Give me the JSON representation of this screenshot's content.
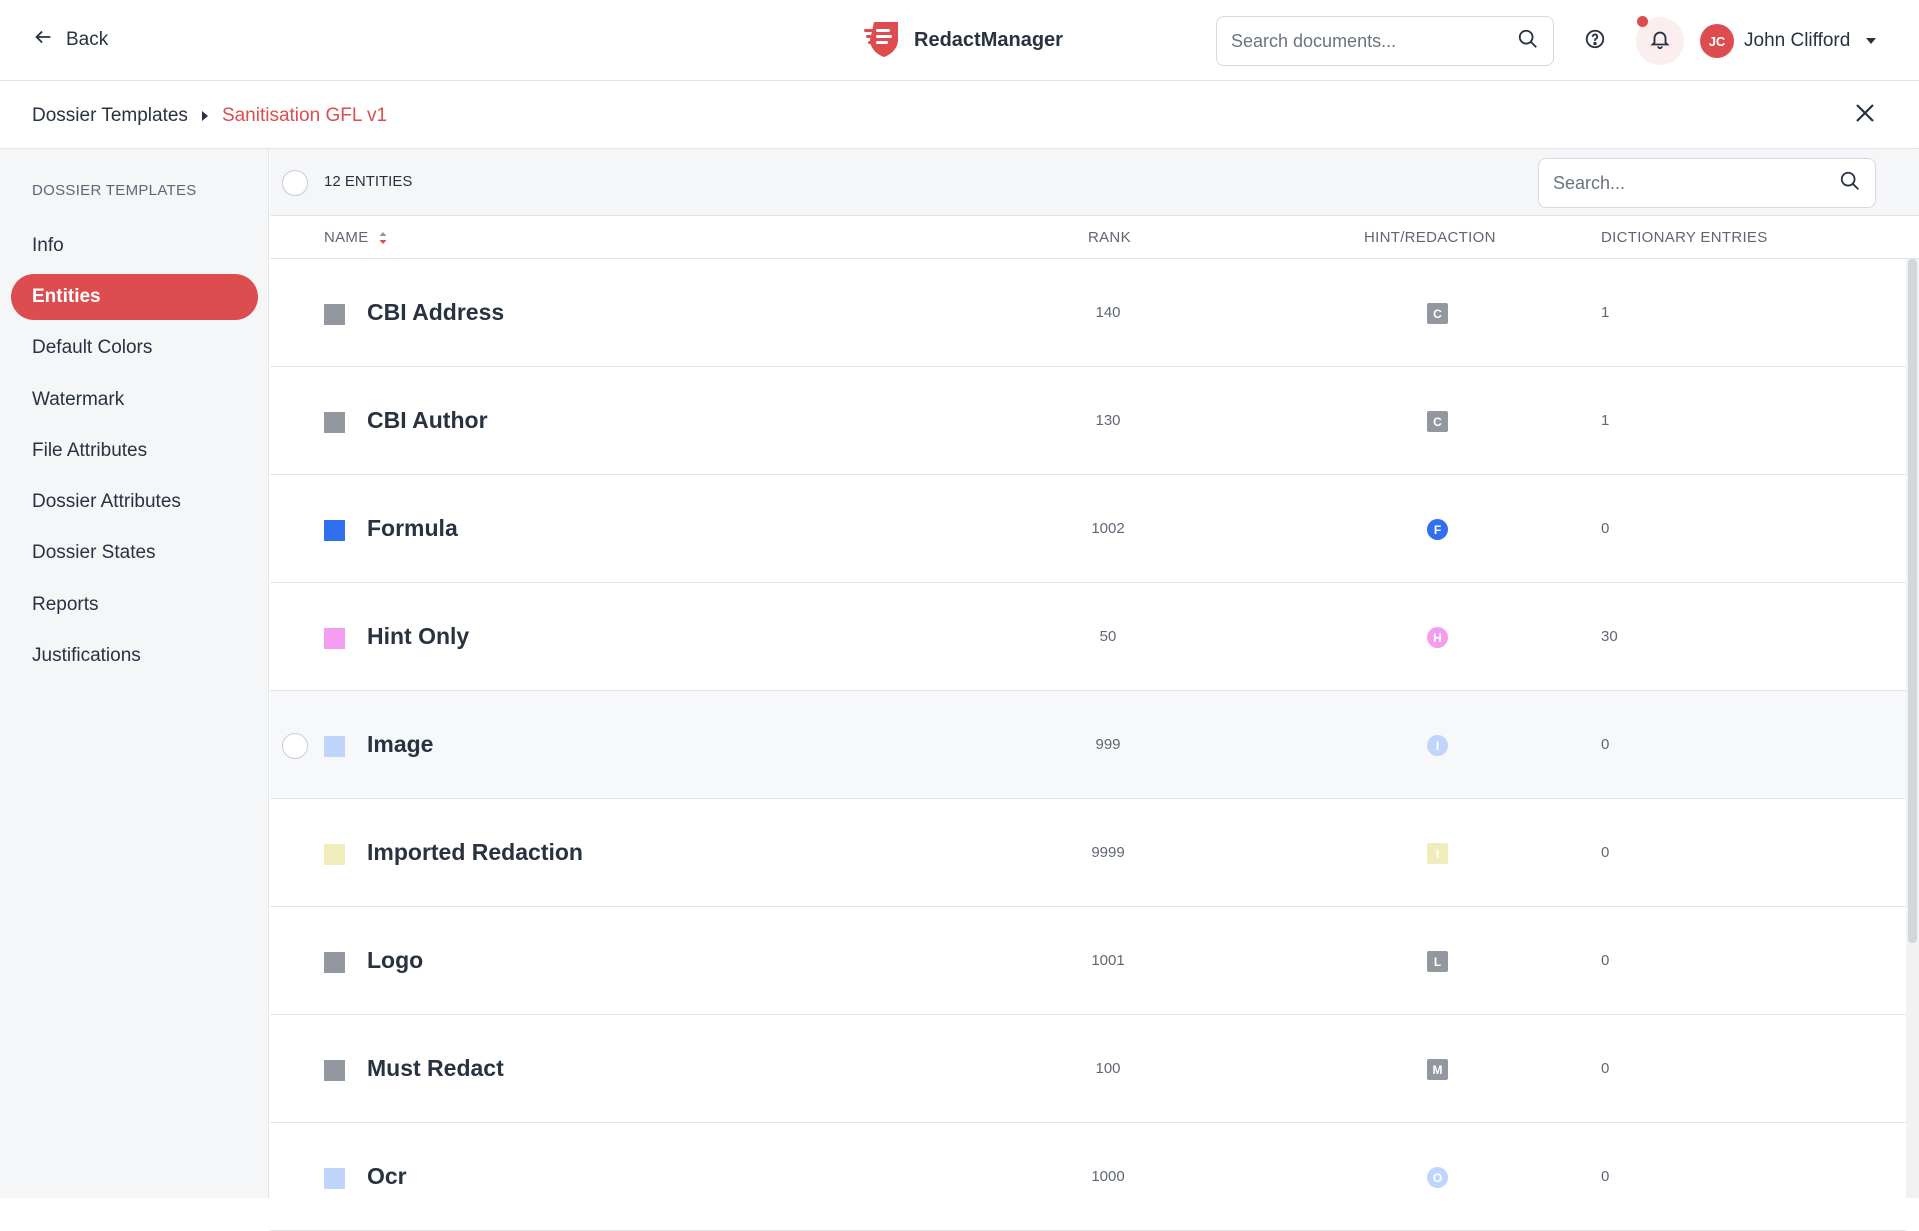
{
  "header": {
    "back_label": "Back",
    "brand_name": "RedactManager",
    "search_placeholder": "Search documents...",
    "user_initials": "JC",
    "user_name": "John Clifford",
    "brand_color": "#dd4d50"
  },
  "breadcrumb": {
    "parent": "Dossier Templates",
    "current": "Sanitisation GFL v1"
  },
  "sidebar": {
    "title": "DOSSIER TEMPLATES",
    "items": [
      {
        "label": "Info",
        "active": false
      },
      {
        "label": "Entities",
        "active": true
      },
      {
        "label": "Default Colors",
        "active": false
      },
      {
        "label": "Watermark",
        "active": false
      },
      {
        "label": "File Attributes",
        "active": false
      },
      {
        "label": "Dossier Attributes",
        "active": false
      },
      {
        "label": "Dossier States",
        "active": false
      },
      {
        "label": "Reports",
        "active": false
      },
      {
        "label": "Justifications",
        "active": false
      }
    ]
  },
  "list": {
    "count_label": "12 ENTITIES",
    "search_placeholder": "Search...",
    "columns": {
      "name": "NAME",
      "rank": "RANK",
      "hint_redaction": "HINT/REDACTION",
      "dictionary_entries": "DICTIONARY ENTRIES"
    },
    "rows": [
      {
        "name": "CBI Address",
        "rank": "140",
        "badge": "C",
        "badge_shape": "square",
        "color": "#9398a0",
        "entries": "1"
      },
      {
        "name": "CBI Author",
        "rank": "130",
        "badge": "C",
        "badge_shape": "square",
        "color": "#9398a0",
        "entries": "1"
      },
      {
        "name": "Formula",
        "rank": "1002",
        "badge": "F",
        "badge_shape": "round",
        "color": "#2f6ff0",
        "entries": "0"
      },
      {
        "name": "Hint Only",
        "rank": "50",
        "badge": "H",
        "badge_shape": "round",
        "color": "#f49cf0",
        "entries": "30"
      },
      {
        "name": "Image",
        "rank": "999",
        "badge": "I",
        "badge_shape": "round",
        "color": "#bfd5fb",
        "entries": "0"
      },
      {
        "name": "Imported Redaction",
        "rank": "9999",
        "badge": "I",
        "badge_shape": "square",
        "color": "#f1ecbc",
        "entries": "0"
      },
      {
        "name": "Logo",
        "rank": "1001",
        "badge": "L",
        "badge_shape": "square",
        "color": "#9398a0",
        "entries": "0"
      },
      {
        "name": "Must Redact",
        "rank": "100",
        "badge": "M",
        "badge_shape": "square",
        "color": "#9398a0",
        "entries": "0"
      },
      {
        "name": "Ocr",
        "rank": "1000",
        "badge": "O",
        "badge_shape": "round",
        "color": "#bfd5fb",
        "entries": "0"
      }
    ]
  }
}
